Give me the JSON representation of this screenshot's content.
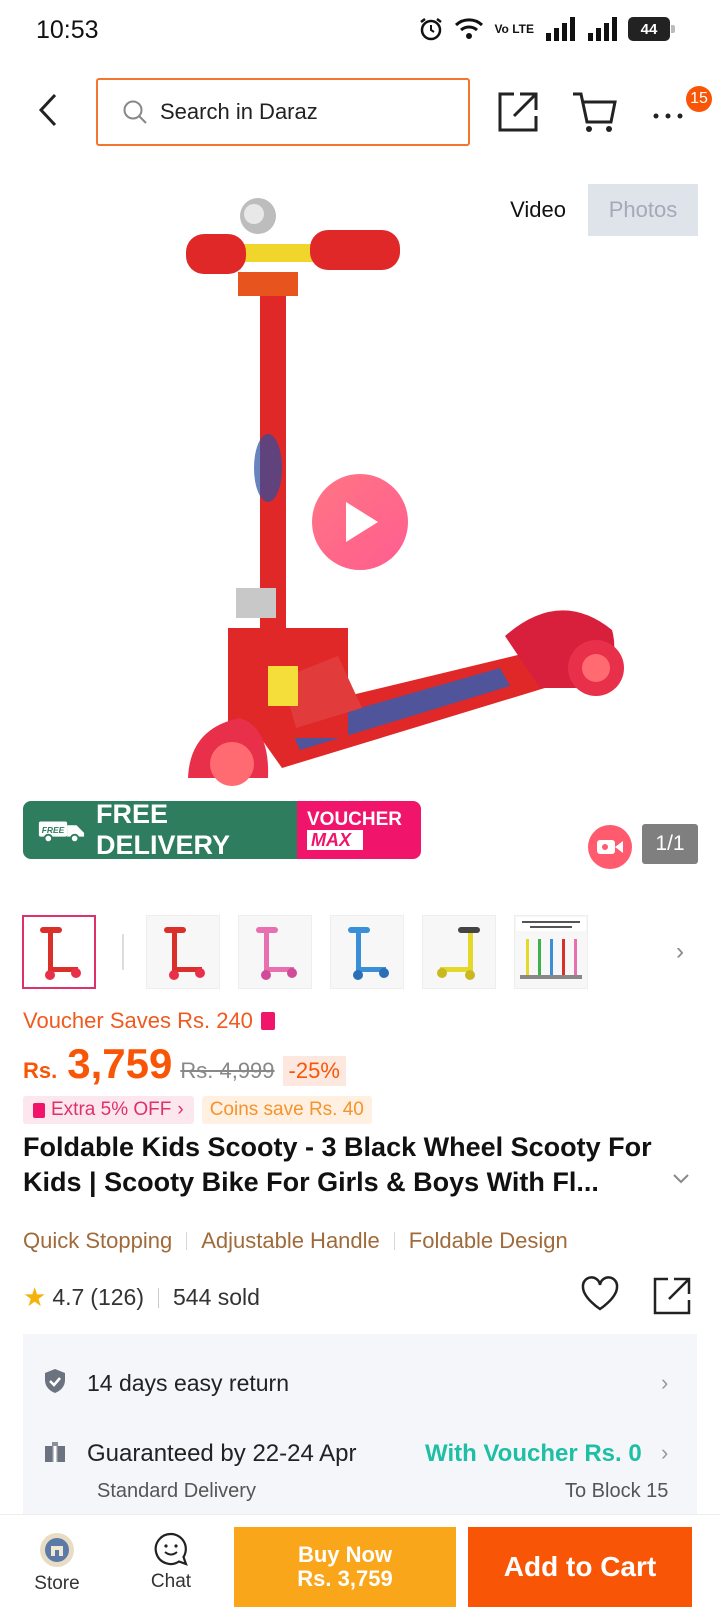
{
  "status_bar": {
    "time": "10:53",
    "network_label": "Vo LTE",
    "battery": "44"
  },
  "header": {
    "search_placeholder": "Search in Daraz",
    "cart_badge": "15"
  },
  "gallery": {
    "tab_video": "Video",
    "tab_photos": "Photos",
    "counter": "1/1",
    "promo_free_delivery": "FREE DELIVERY",
    "promo_free_tag": "FREE",
    "promo_voucher": "VOUCHER",
    "promo_max": "MAX",
    "thumbnails": [
      {
        "color": "#d9302a",
        "active": true
      },
      {
        "color": "#d9302a",
        "active": false
      },
      {
        "color": "#e86fb0",
        "active": false
      },
      {
        "color": "#3b8fd6",
        "active": false
      },
      {
        "color": "#e4d92a",
        "active": false
      },
      {
        "color": "multicolor",
        "active": false
      }
    ]
  },
  "pricing": {
    "voucher_saves": "Voucher Saves Rs. 240",
    "currency": "Rs.",
    "price": "3,759",
    "original_price": "Rs. 4,999",
    "discount": "-25%",
    "extra_off": "Extra 5% OFF",
    "coins_save": "Coins save Rs. 40"
  },
  "product": {
    "title": "Foldable Kids Scooty - 3 Black Wheel Scooty For Kids | Scooty Bike For Girls & Boys With Fl...",
    "features": [
      "Quick Stopping",
      "Adjustable Handle",
      "Foldable Design"
    ],
    "rating": "4.7",
    "reviews": "(126)",
    "sold": "544 sold"
  },
  "services": {
    "return_text": "14 days easy return",
    "delivery_text": "Guaranteed by 22-24 Apr",
    "delivery_voucher": "With Voucher Rs. 0",
    "delivery_type": "Standard Delivery",
    "delivery_location": "To Block 15"
  },
  "bottom_bar": {
    "store_label": "Store",
    "chat_label": "Chat",
    "buy_now_line1": "Buy Now",
    "buy_now_line2": "Rs. 3,759",
    "add_to_cart": "Add to Cart"
  },
  "colors": {
    "brand": "#f85606",
    "buy_now": "#faa61a",
    "free_delivery": "#2e7d5e",
    "voucher": "#f0146b",
    "feature_text": "#a06a3a"
  }
}
